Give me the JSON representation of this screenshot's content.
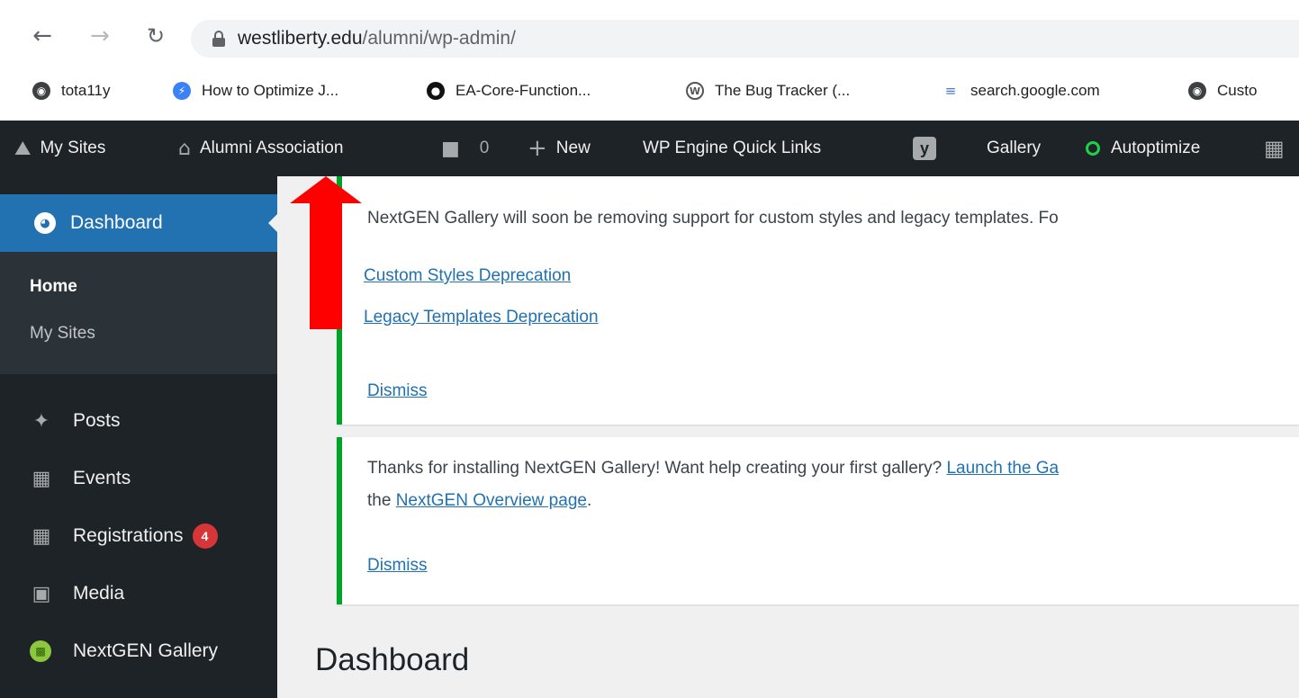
{
  "browser": {
    "url_host": "westliberty.edu",
    "url_path": "/alumni/wp-admin/",
    "bookmarks": [
      {
        "label": "tota11y",
        "icon": "globe-icon"
      },
      {
        "label": "How to Optimize J...",
        "icon": "blue-circle-icon"
      },
      {
        "label": "EA-Core-Function...",
        "icon": "github-icon"
      },
      {
        "label": "The Bug Tracker (...",
        "icon": "wordpress-icon"
      },
      {
        "label": "search.google.com",
        "icon": "google-search-icon"
      },
      {
        "label": "Custo",
        "icon": "globe-icon"
      }
    ]
  },
  "adminbar": {
    "my_sites": "My Sites",
    "site_name": "Alumni Association",
    "comments_count": "0",
    "new_label": "New",
    "wp_engine": "WP Engine Quick Links",
    "gallery": "Gallery",
    "autoptimize": "Autoptimize"
  },
  "sidebar": {
    "dashboard": "Dashboard",
    "submenu": [
      "Home",
      "My Sites"
    ],
    "items": [
      {
        "label": "Posts",
        "icon": "pin-icon"
      },
      {
        "label": "Events",
        "icon": "calendar-icon"
      },
      {
        "label": "Registrations",
        "icon": "calendar-icon",
        "badge": "4"
      },
      {
        "label": "Media",
        "icon": "media-icon"
      },
      {
        "label": "NextGEN Gallery",
        "icon": "nextgen-icon"
      }
    ]
  },
  "notices": {
    "n1_text": "NextGEN Gallery will soon be removing support for custom styles and legacy templates. Fo",
    "n1_link1": "Custom Styles Deprecation",
    "n1_link2": "Legacy Templates Deprecation",
    "n1_dismiss": "Dismiss",
    "n2_text_pre": "Thanks for installing NextGEN Gallery! Want help creating your first gallery? ",
    "n2_link_launch": "Launch the Ga",
    "n2_text_the": "the ",
    "n2_link_overview": "NextGEN Overview page",
    "n2_text_post": ".",
    "n2_dismiss": "Dismiss"
  },
  "page_title": "Dashboard",
  "colors": {
    "adminbar_bg": "#1d2327",
    "active_menu": "#2271b1",
    "notice_border": "#00a32a",
    "annotation_arrow": "#ff0000",
    "badge": "#d63638"
  }
}
